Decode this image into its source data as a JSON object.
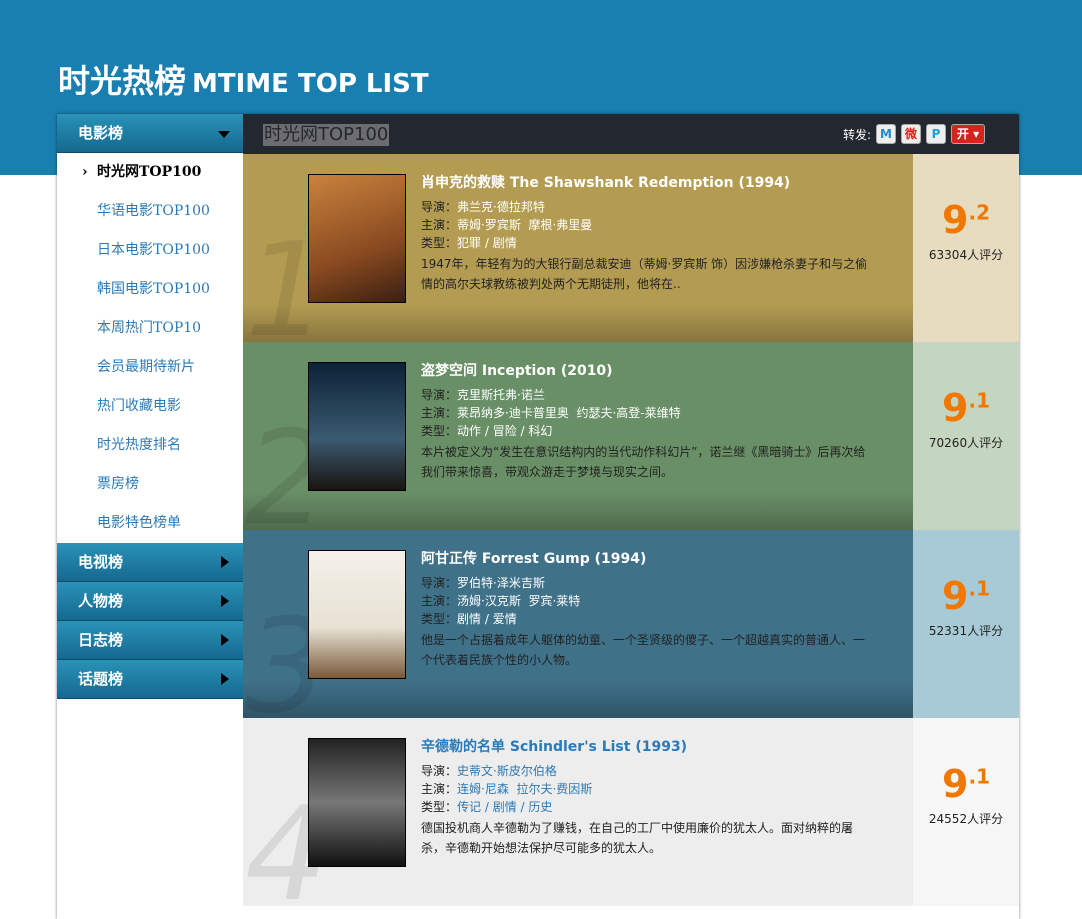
{
  "header": {
    "title_cn": "时光热榜",
    "title_en": "MTIME TOP LIST"
  },
  "sidebar": {
    "open_category": "电影榜",
    "items": [
      {
        "label": "时光网TOP100",
        "active": true
      },
      {
        "label": "华语电影TOP100"
      },
      {
        "label": "日本电影TOP100"
      },
      {
        "label": "韩国电影TOP100"
      },
      {
        "label": "本周热门TOP10"
      },
      {
        "label": "会员最期待新片"
      },
      {
        "label": "热门收藏电影"
      },
      {
        "label": "时光热度排名"
      },
      {
        "label": "票房榜"
      },
      {
        "label": "电影特色榜单"
      }
    ],
    "categories": [
      "电视榜",
      "人物榜",
      "日志榜",
      "话题榜"
    ]
  },
  "topbar": {
    "title": "时光网TOP100",
    "share_label": "转发:",
    "share_icons": [
      "M",
      "微",
      "P",
      "开"
    ]
  },
  "labels": {
    "director": "导演：",
    "cast": "主演：",
    "genre": "类型："
  },
  "movies": [
    {
      "rank": "1",
      "title": "肖申克的救赎 The Shawshank Redemption (1994)",
      "director": "弗兰克·德拉邦特",
      "cast": "蒂姆·罗宾斯  摩根·弗里曼",
      "genre": "犯罪 / 剧情",
      "desc": "1947年，年轻有为的大银行副总裁安迪（蒂姆·罗宾斯 饰）因涉嫌枪杀妻子和与之偷情的高尔夫球教练被判处两个无期徒刑，他将在..",
      "score_int": "9",
      "score_dec": ".2",
      "votes": "63304人评分",
      "bg": "#b39c52",
      "score_bg": "#e8dcc0"
    },
    {
      "rank": "2",
      "title": "盗梦空间 Inception (2010)",
      "director": "克里斯托弗·诺兰",
      "cast": "莱昂纳多·迪卡普里奥  约瑟夫·高登-莱维特",
      "genre": "动作 / 冒险 / 科幻",
      "desc": "本片被定义为“发生在意识结构内的当代动作科幻片”，诺兰继《黑暗骑士》后再次给我们带来惊喜，带观众游走于梦境与现实之间。",
      "score_int": "9",
      "score_dec": ".1",
      "votes": "70260人评分",
      "bg": "#698f66",
      "score_bg": "#c5d6c0"
    },
    {
      "rank": "3",
      "title": "阿甘正传 Forrest Gump (1994)",
      "director": "罗伯特·泽米吉斯",
      "cast": "汤姆·汉克斯  罗宾·莱特",
      "genre": "剧情 / 爱情",
      "desc": "他是一个占据着成年人躯体的幼童、一个圣贤级的傻子、一个超越真实的普通人、一个代表着民族个性的小人物。",
      "score_int": "9",
      "score_dec": ".1",
      "votes": "52331人评分",
      "bg": "#3f7189",
      "score_bg": "#a8cad6"
    },
    {
      "rank": "4",
      "title": "辛德勒的名单 Schindler's List (1993)",
      "director": "史蒂文·斯皮尔伯格",
      "cast": "连姆·尼森  拉尔夫·费因斯",
      "genre": "传记 / 剧情 / 历史",
      "desc": "德国投机商人辛德勒为了赚钱，在自己的工厂中使用廉价的犹太人。面对纳粹的屠杀，辛德勒开始想法保护尽可能多的犹太人。",
      "score_int": "9",
      "score_dec": ".1",
      "votes": "24552人评分",
      "bg": "#ededed",
      "score_bg": "#f6f6f6"
    }
  ]
}
